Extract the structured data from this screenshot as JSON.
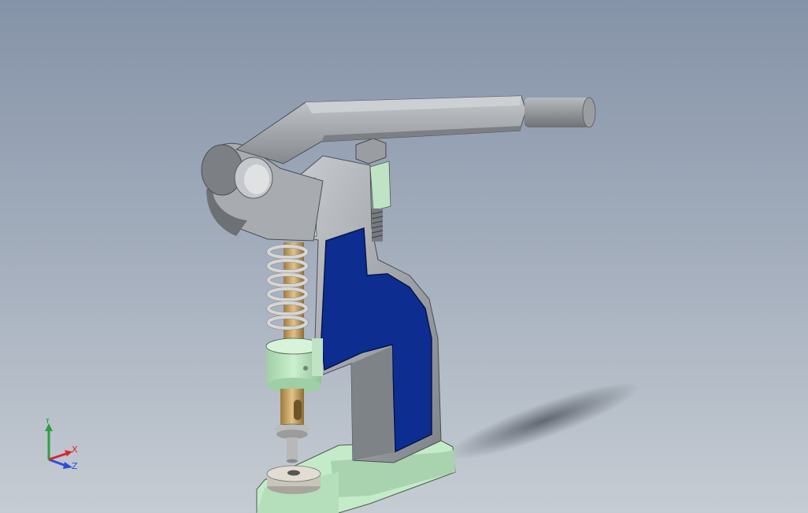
{
  "viewport": {
    "background_top": "#8593a8",
    "background_bottom": "#c6ccd3"
  },
  "model": {
    "colors": {
      "frame_section": "#0d2d91",
      "frame_body": "#9ba0a6",
      "frame_cap": "#bfe3c4",
      "handle": "#a9acb0",
      "grip": "#8a8d91",
      "spring": "#d4d4d4",
      "plunger": "#c7a366",
      "base": "#c4ebc8"
    }
  },
  "triad": {
    "y_label": "Y",
    "x_label": "X",
    "z_label": "Z",
    "y_color": "#2ea043",
    "x_color": "#d9262f",
    "z_color": "#2b4fd6"
  }
}
